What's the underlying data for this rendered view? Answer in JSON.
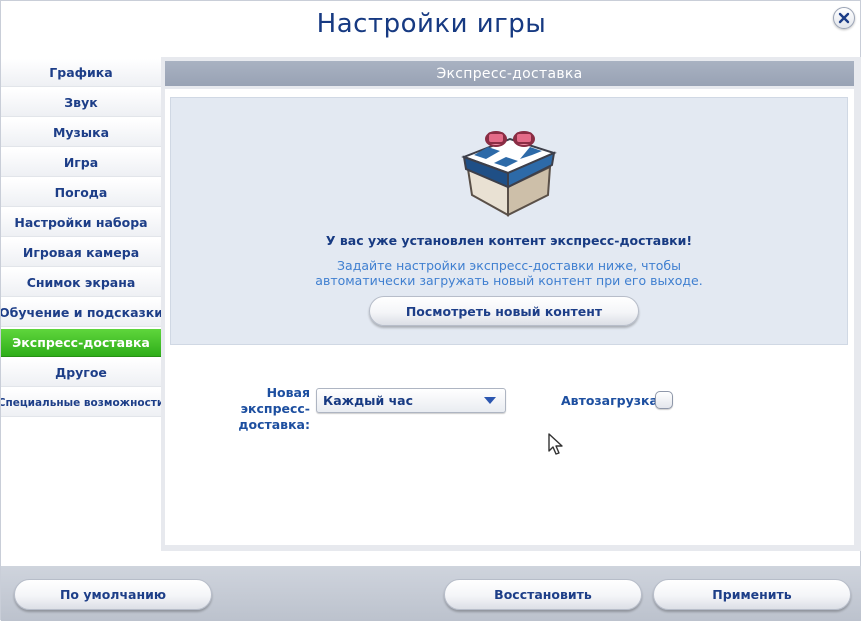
{
  "window": {
    "title": "Настройки игры"
  },
  "sidebar": {
    "items": [
      {
        "label": "Графика"
      },
      {
        "label": "Звук"
      },
      {
        "label": "Музыка"
      },
      {
        "label": "Игра"
      },
      {
        "label": "Погода"
      },
      {
        "label": "Настройки набора"
      },
      {
        "label": "Игровая камера"
      },
      {
        "label": "Снимок экрана"
      },
      {
        "label": "Обучение и подсказки"
      },
      {
        "label": "Экспресс-доставка",
        "active": true
      },
      {
        "label": "Другое"
      },
      {
        "label": "Специальные возможности"
      }
    ]
  },
  "section": {
    "header": "Экспресс-доставка",
    "info_heading": "У вас уже установлен контент экспресс-доставки!",
    "info_text": "Задайте настройки экспресс-доставки ниже, чтобы автоматически загружать новый контент при его выходе.",
    "view_button": "Посмотреть новый контент",
    "icon": "gift-box-icon"
  },
  "settings": {
    "new_delivery_label": "Новая экспресс-доставка:",
    "new_delivery_value": "Каждый час",
    "autodownload_label": "Автозагрузка",
    "autodownload_checked": false
  },
  "footer": {
    "default_label": "По умолчанию",
    "restore_label": "Восстановить",
    "apply_label": "Применить"
  },
  "colors": {
    "accent_active": "#3cbf22",
    "title_blue": "#173a82",
    "header_gray": "#a3acbc"
  }
}
